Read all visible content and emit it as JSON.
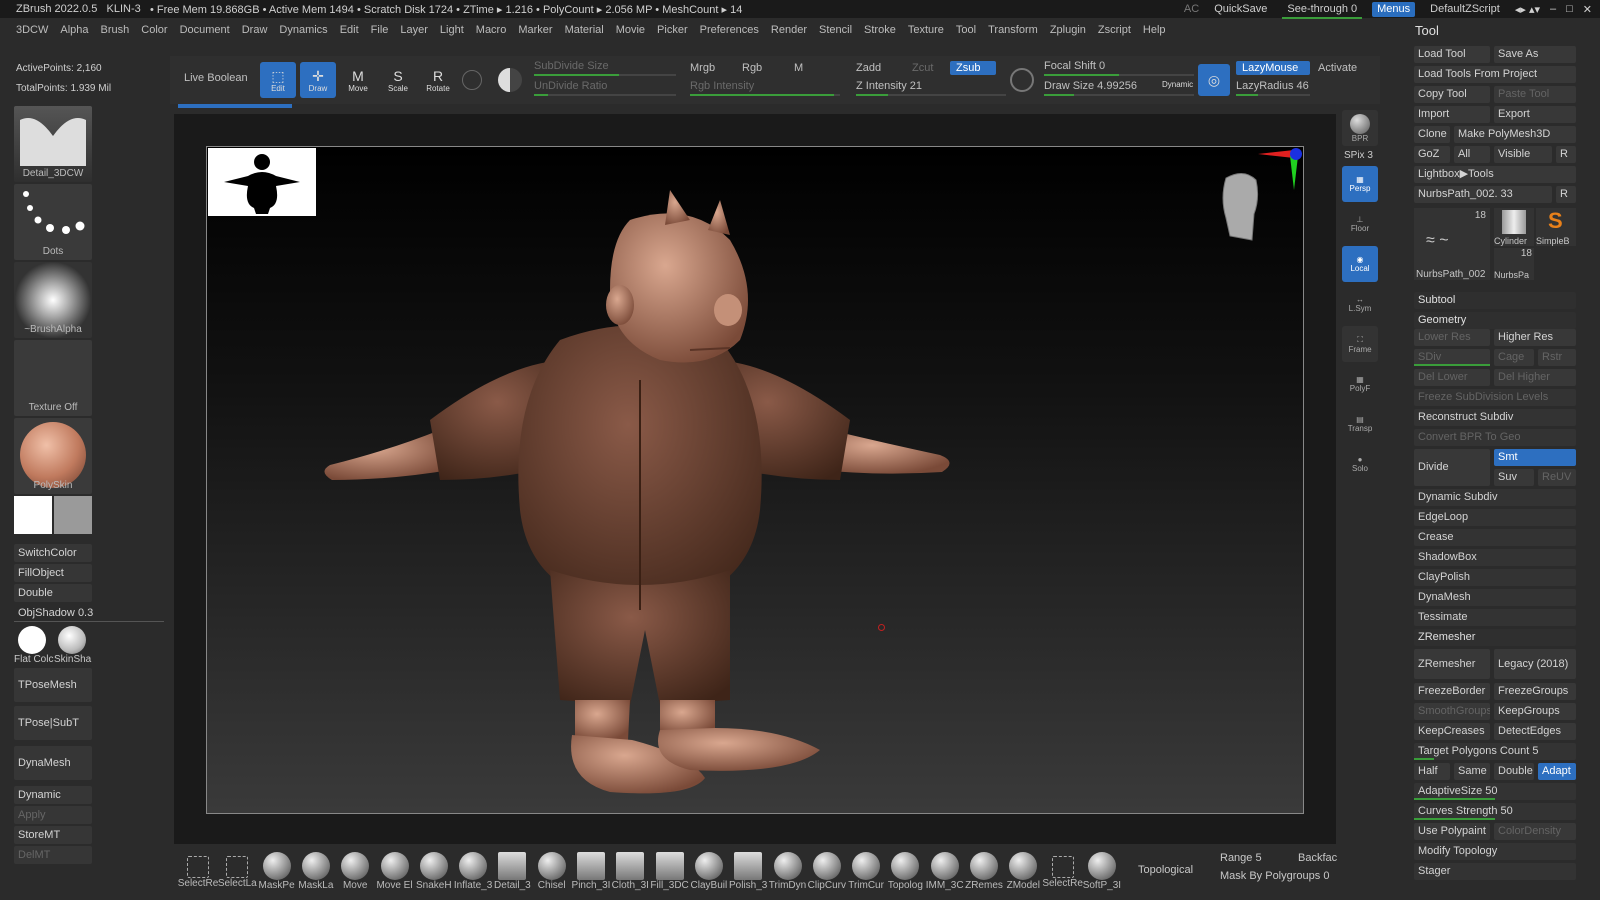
{
  "titlebar": {
    "app": "ZBrush 2022.0.5",
    "doc": "KLIN-3",
    "stats": "• Free Mem 19.868GB • Active Mem 1494 • Scratch Disk 1724 • ZTime ▸ 1.216 • PolyCount ▸ 2.056 MP • MeshCount ▸ 14",
    "ac": "AC",
    "quicksave": "QuickSave",
    "see_through": "See-through  0",
    "menus": "Menus",
    "script": "DefaultZScript"
  },
  "menubar": [
    "3DCW",
    "Alpha",
    "Brush",
    "Color",
    "Document",
    "Draw",
    "Dynamics",
    "Edit",
    "File",
    "Layer",
    "Light",
    "Macro",
    "Marker",
    "Material",
    "Movie",
    "Picker",
    "Preferences",
    "Render",
    "Stencil",
    "Stroke",
    "Texture",
    "Tool",
    "Transform",
    "Zplugin",
    "Zscript",
    "Help"
  ],
  "left": {
    "active_points": "ActivePoints: 2,160",
    "total_points": "TotalPoints: 1.939 Mil",
    "brush_label": "Detail_3DCW",
    "stroke_label": "Dots",
    "alpha_label": "~BrushAlpha",
    "texture_label": "Texture Off",
    "material_label": "PolySkin",
    "switch_color": "SwitchColor",
    "fill_object": "FillObject",
    "double": "Double",
    "obj_shadow": "ObjShadow",
    "obj_shadow_value": "0.3",
    "flat_color": "Flat Colc",
    "skin_shade": "SkinSha",
    "tpose_mesh": "TPoseMesh",
    "tpose_subt": "TPose|SubT",
    "dynamesh": "DynaMesh",
    "dynamic": "Dynamic",
    "apply": "Apply",
    "store_mt": "StoreMT",
    "del_mt": "DelMT"
  },
  "topshelf": {
    "live_boolean": "Live Boolean",
    "edit": "Edit",
    "draw": "Draw",
    "move": "Move",
    "scale": "Scale",
    "rotate": "Rotate",
    "subdivide_size": "SubDivide Size",
    "undivide_ratio": "UnDivide Ratio",
    "mrgb": "Mrgb",
    "rgb": "Rgb",
    "m": "M",
    "rgb_intensity": "Rgb Intensity",
    "zadd": "Zadd",
    "zcut": "Zcut",
    "zsub": "Zsub",
    "z_intensity": "Z Intensity 21",
    "focal_shift": "Focal Shift 0",
    "draw_size": "Draw Size 4.99256",
    "dynamic": "Dynamic",
    "lazy_mouse": "LazyMouse",
    "lazy_radius": "LazyRadius 46",
    "activate": "Activate"
  },
  "rightdock": {
    "bpr": "BPR",
    "spix": "SPix 3",
    "persp": "Persp",
    "floor": "Floor",
    "local": "Local",
    "lsym": "L.Sym",
    "frame": "Frame",
    "polyf": "PolyF",
    "transp": "Transp",
    "solo": "Solo"
  },
  "tool": {
    "title": "Tool",
    "load_tool": "Load Tool",
    "save_as": "Save As",
    "load_from_project": "Load Tools From Project",
    "copy_tool": "Copy Tool",
    "paste_tool": "Paste Tool",
    "import": "Import",
    "export": "Export",
    "clone": "Clone",
    "make_polymesh": "Make PolyMesh3D",
    "goz": "GoZ",
    "all": "All",
    "visible": "Visible",
    "r": "R",
    "lightbox_tools": "Lightbox▶Tools",
    "current_tool": "NurbsPath_002. 33",
    "thumb1": "NurbsPath_002",
    "thumb1_count": "18",
    "thumb2": "Cylinder",
    "thumb3": "SimpleB",
    "thumb4": "NurbsPa",
    "thumb4_count": "18",
    "subtool": "Subtool",
    "geometry": "Geometry",
    "lower_res": "Lower Res",
    "higher_res": "Higher Res",
    "sdiv": "SDiv",
    "cage": "Cage",
    "rstr": "Rstr",
    "del_lower": "Del Lower",
    "del_higher": "Del Higher",
    "freeze_subdiv": "Freeze SubDivision Levels",
    "reconstruct": "Reconstruct Subdiv",
    "convert_bpr": "Convert BPR To Geo",
    "divide": "Divide",
    "smt": "Smt",
    "suv": "Suv",
    "reuv": "ReUV",
    "dynamic_subdiv": "Dynamic Subdiv",
    "edgeloop": "EdgeLoop",
    "crease": "Crease",
    "shadowbox": "ShadowBox",
    "claypolish": "ClayPolish",
    "dynamesh": "DynaMesh",
    "tessimate": "Tessimate",
    "zremesher_section": "ZRemesher",
    "zremesher": "ZRemesher",
    "legacy": "Legacy (2018)",
    "freeze_border": "FreezeBorder",
    "freeze_groups": "FreezeGroups",
    "smooth_groups": "SmoothGroups",
    "keep_groups": "KeepGroups",
    "keep_creases": "KeepCreases",
    "detect_edges": "DetectEdges",
    "target_poly": "Target Polygons Count 5",
    "half": "Half",
    "same": "Same",
    "double": "Double",
    "adapt": "Adapt",
    "adaptive_size": "AdaptiveSize 50",
    "curves_strength": "Curves Strength 50",
    "use_polypaint": "Use Polypaint",
    "color_density": "ColorDensity",
    "modify_topology": "Modify Topology",
    "stager": "Stager"
  },
  "bottom": {
    "brushes": [
      "SelectRe",
      "SelectLa",
      "MaskPe",
      "MaskLa",
      "Move",
      "Move El",
      "SnakeH",
      "Inflate_3",
      "Detail_3",
      "Chisel",
      "Pinch_3I",
      "Cloth_3I",
      "Fill_3DC",
      "ClayBuil",
      "Polish_3",
      "TrimDyn",
      "ClipCurv",
      "TrimCur",
      "Topolog",
      "IMM_3C",
      "ZRemes",
      "ZModel",
      "SelectRe",
      "SoftP_3I"
    ],
    "topological": "Topological",
    "range": "Range 5",
    "mask_by_poly": "Mask By Polygroups 0",
    "backface": "Backfac"
  },
  "colors": {
    "accent": "#2d6fc0",
    "slider_green": "#3a9d3a",
    "clay": "#8a5a48"
  }
}
